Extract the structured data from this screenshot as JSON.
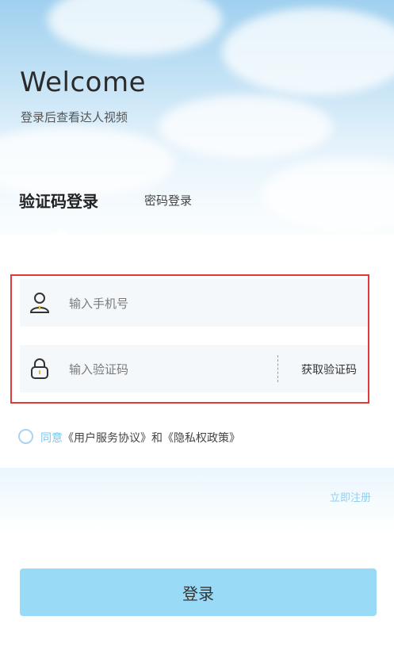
{
  "header": {
    "title": "Welcome",
    "subtitle": "登录后查看达人视频"
  },
  "tabs": [
    {
      "label": "验证码登录",
      "active": true
    },
    {
      "label": "密码登录",
      "active": false
    }
  ],
  "form": {
    "phone": {
      "placeholder": "输入手机号",
      "icon": "user-icon"
    },
    "code": {
      "placeholder": "输入验证码",
      "icon": "lock-icon",
      "button_label": "获取验证码"
    }
  },
  "agreement": {
    "prefix": "同意",
    "text": "《用户服务协议》和《隐私权政策》"
  },
  "register_label": "立即注册",
  "login_label": "登录",
  "colors": {
    "accent": "#99dbf7",
    "highlight_border": "#e23a3a",
    "link": "#8fd0f1"
  }
}
